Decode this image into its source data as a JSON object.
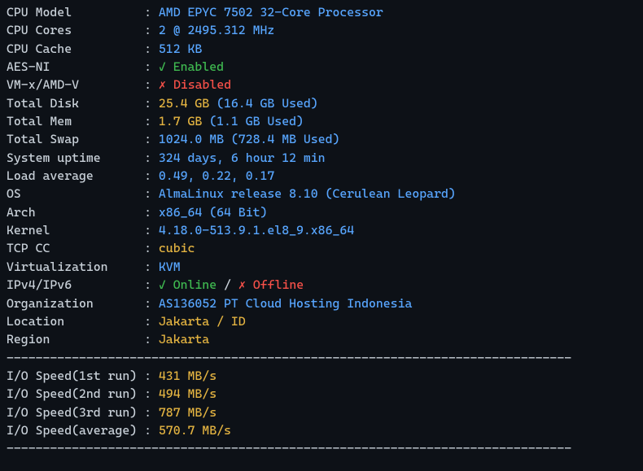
{
  "sep": "------------------------------------------------------------------------------",
  "sys": [
    {
      "label": "CPU Model",
      "pad": "          ",
      "value": "AMD EPYC 7502 32-Core Processor",
      "cls": "val-blue"
    },
    {
      "label": "CPU Cores",
      "pad": "          ",
      "value": "2 @ 2495.312 MHz",
      "cls": "val-blue"
    },
    {
      "label": "CPU Cache",
      "pad": "          ",
      "value": "512 KB",
      "cls": "val-blue"
    },
    {
      "label": "AES-NI",
      "pad": "             ",
      "mark": "✓",
      "markcls": "check",
      "status": " Enabled",
      "statuscls": "green-txt"
    },
    {
      "label": "VM-x/AMD-V",
      "pad": "         ",
      "mark": "✗",
      "markcls": "cross",
      "status": " Disabled",
      "statuscls": "red-txt"
    },
    {
      "label": "Total Disk",
      "pad": "         ",
      "value": "25.4 GB ",
      "cls": "val-yellow",
      "paren": "(16.4 GB Used)",
      "parencls": "val-blue"
    },
    {
      "label": "Total Mem",
      "pad": "          ",
      "value": "1.7 GB ",
      "cls": "val-yellow",
      "paren": "(1.1 GB Used)",
      "parencls": "val-blue"
    },
    {
      "label": "Total Swap",
      "pad": "         ",
      "value": "1024.0 MB ",
      "cls": "val-blue",
      "paren": "(728.4 MB Used)",
      "parencls": "val-blue"
    },
    {
      "label": "System uptime",
      "pad": "      ",
      "value": "324 days, 6 hour 12 min",
      "cls": "val-blue"
    },
    {
      "label": "Load average",
      "pad": "       ",
      "value": "0.49, 0.22, 0.17",
      "cls": "val-blue"
    },
    {
      "label": "OS",
      "pad": "                 ",
      "value": "AlmaLinux release 8.10 (Cerulean Leopard)",
      "cls": "val-blue"
    },
    {
      "label": "Arch",
      "pad": "               ",
      "value": "x86_64 (64 Bit)",
      "cls": "val-blue"
    },
    {
      "label": "Kernel",
      "pad": "             ",
      "value": "4.18.0-513.9.1.el8_9.x86_64",
      "cls": "val-blue"
    },
    {
      "label": "TCP CC",
      "pad": "             ",
      "value": "cubic",
      "cls": "val-yellow"
    },
    {
      "label": "Virtualization",
      "pad": "     ",
      "value": "KVM",
      "cls": "val-blue"
    },
    {
      "label": "IPv4/IPv6",
      "pad": "          ",
      "net_a_mark": "✓",
      "net_a_txt": " Online",
      "net_sep": " / ",
      "net_b_mark": "✗",
      "net_b_txt": " Offline"
    },
    {
      "label": "Organization",
      "pad": "       ",
      "value": "AS136052 PT Cloud Hosting Indonesia",
      "cls": "val-blue"
    },
    {
      "label": "Location",
      "pad": "           ",
      "value": "Jakarta / ID",
      "cls": "val-yellow"
    },
    {
      "label": "Region",
      "pad": "             ",
      "value": "Jakarta",
      "cls": "val-yellow"
    }
  ],
  "io": [
    {
      "label": "I/O Speed(1st run) ",
      "value": "431 MB/s"
    },
    {
      "label": "I/O Speed(2nd run) ",
      "value": "494 MB/s"
    },
    {
      "label": "I/O Speed(3rd run) ",
      "value": "787 MB/s"
    },
    {
      "label": "I/O Speed(average) ",
      "value": "570.7 MB/s"
    }
  ]
}
